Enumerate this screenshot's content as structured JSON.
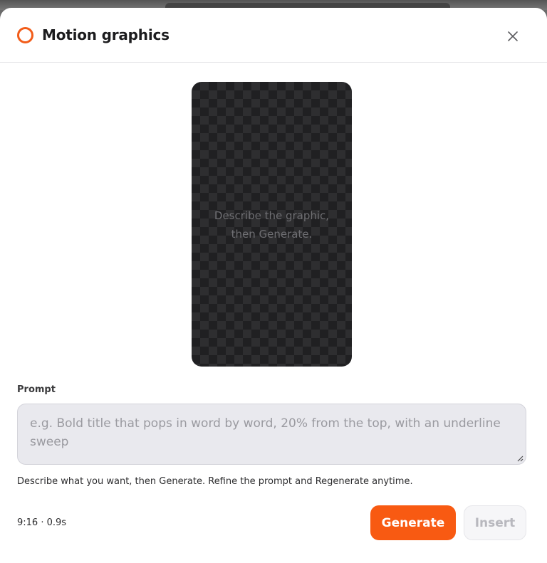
{
  "dialog": {
    "title": "Motion graphics",
    "brand_color": "#f25c19",
    "close_icon": "close-icon"
  },
  "preview": {
    "empty_text": "Describe the graphic,\nthen Generate.",
    "aspect": "9:16",
    "background": "checkerboard"
  },
  "prompt": {
    "label": "Prompt",
    "value": "",
    "placeholder": "e.g. Bold title that pops in word by word, 20% from the top, with an underline sweep"
  },
  "helper_text": "Describe what you want, then Generate. Refine the prompt and Regenerate anytime.",
  "footer": {
    "meta": "9:16 · 0.9s",
    "generate_label": "Generate",
    "insert_label": "Insert",
    "generate_color": "#f85a12"
  }
}
